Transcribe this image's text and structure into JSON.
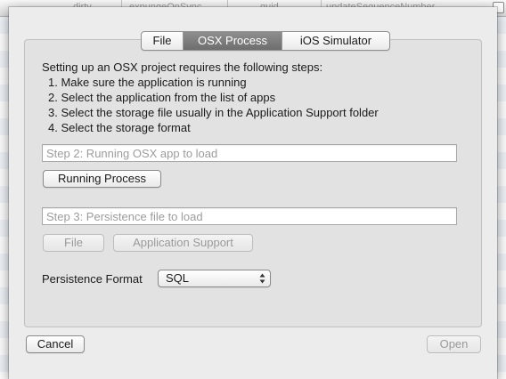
{
  "background": {
    "columns": [
      "dirty",
      "expungeOnSync",
      "guid",
      "updateSequenceNumber"
    ]
  },
  "tabs": [
    {
      "label": "File",
      "active": false
    },
    {
      "label": "OSX Process",
      "active": true
    },
    {
      "label": "iOS Simulator",
      "active": false
    }
  ],
  "intro": {
    "heading": "Setting up an OSX project requires the following steps:",
    "steps": [
      "1. Make sure the application is running",
      "2. Select the application from the list of apps",
      "3. Select the storage file usually in the Application Support folder",
      "4. Select the storage format"
    ]
  },
  "step2": {
    "placeholder": "Step 2: Running OSX app to load",
    "button_label": "Running Process"
  },
  "step3": {
    "placeholder": "Step 3: Persistence file to load",
    "file_button_label": "File",
    "app_support_button_label": "Application Support"
  },
  "persistence": {
    "label": "Persistence Format",
    "selected": "SQL"
  },
  "footer": {
    "cancel_label": "Cancel",
    "open_label": "Open"
  },
  "colors": {
    "active_tab": "#7e7e7e",
    "sheet_bg": "#ececec",
    "panel_bg": "#e2e2e2"
  }
}
